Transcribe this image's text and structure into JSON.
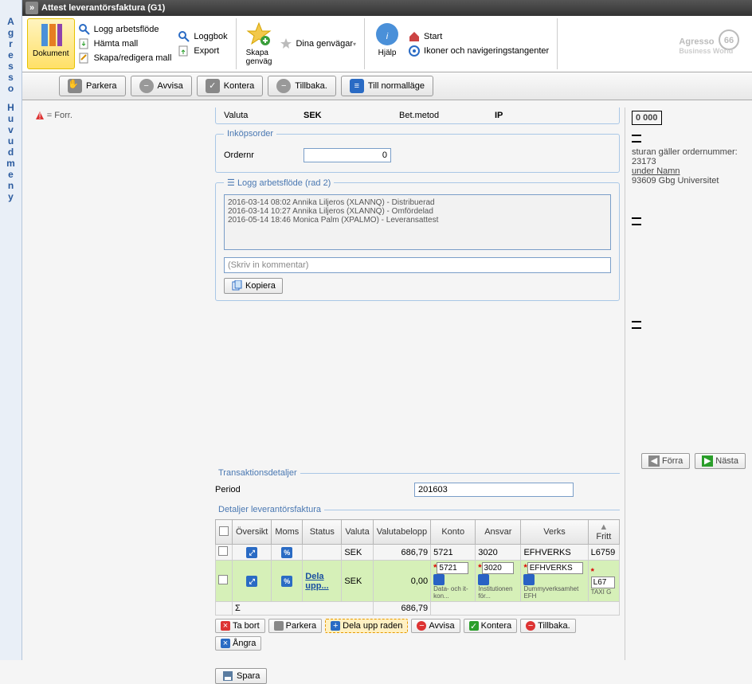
{
  "window": {
    "title": "Attest leverantörsfaktura (G1)"
  },
  "ribbon": {
    "dokument": "Dokument",
    "logg_flode": "Logg arbetsflöde",
    "hamta_mall": "Hämta mall",
    "skapa_redigera_mall": "Skapa/redigera mall",
    "loggbok": "Loggbok",
    "export": "Export",
    "skapa_genvag": "Skapa\ngenväg",
    "dina_genvagar": "Dina genvägar",
    "hjalp": "Hjälp",
    "start": "Start",
    "ikoner_nav": "Ikoner och navigeringstangenter",
    "brand": "Agresso",
    "brand_sub": "Business World"
  },
  "actions": {
    "parkera": "Parkera",
    "avvisa": "Avvisa",
    "kontera": "Kontera",
    "tillbaka": "Tillbaka.",
    "normallage": "Till normalläge"
  },
  "left_rail": "Agresso Huvudmeny",
  "status_text": "= Forr.",
  "form": {
    "valuta_label": "Valuta",
    "valuta_value": "SEK",
    "betmetod_label": "Bet.metod",
    "betmetod_value": "IP",
    "inkopsorder": "Inköpsorder",
    "ordernr_label": "Ordernr",
    "ordernr_value": "0",
    "logg_legend": "Logg arbetsflöde (rad 2)",
    "logg_lines": "2016-03-14 08:02 Annika Liljeros (XLANNQ) - Distribuerad\n2016-03-14 10:27 Annika Liljeros (XLANNQ) - Omfördelad\n2016-05-14 18:46 Monica Palm (XPALMO) - Leveransattest",
    "comment_placeholder": "(Skriv in kommentar)",
    "kopiera": "Kopiera"
  },
  "doc_preview": {
    "line1": "0 000",
    "line2": "sturan gäller ordernummer: 23173",
    "line3": "under Namn",
    "line4": "93609 Gbg Universitet"
  },
  "nav": {
    "forra": "Förra",
    "nasta": "Nästa"
  },
  "trans": {
    "legend": "Transaktionsdetaljer",
    "period_label": "Period",
    "period_value": "201603"
  },
  "detail": {
    "legend": "Detaljer leverantörsfaktura",
    "headers": {
      "oversikt": "Översikt",
      "moms": "Moms",
      "status": "Status",
      "valuta": "Valuta",
      "valutabelopp": "Valutabelopp",
      "konto": "Konto",
      "ansvar": "Ansvar",
      "verks": "Verks",
      "fritt": "Fritt"
    },
    "row1": {
      "valuta": "SEK",
      "belopp": "686,79",
      "konto": "5721",
      "ansvar": "3020",
      "verks": "EFHVERKS",
      "fritt": "L6759"
    },
    "row2": {
      "status": "Dela upp...",
      "valuta": "SEK",
      "belopp": "0,00",
      "konto": "5721",
      "konto_sub": "Data- och it-kon...",
      "ansvar": "3020",
      "ansvar_sub": "Institutionen för...",
      "verks": "EFHVERKS",
      "verks_sub": "Dummyverksamhet EFH",
      "fritt": "L67",
      "fritt_sub": "TAXI G"
    },
    "sum_sym": "Σ",
    "sum_belopp": "686,79"
  },
  "row_actions": {
    "ta_bort": "Ta bort",
    "parkera": "Parkera",
    "dela_upp": "Dela upp raden",
    "avvisa": "Avvisa",
    "kontera": "Kontera",
    "tillbaka": "Tillbaka.",
    "angra": "Ångra"
  },
  "save": "Spara"
}
